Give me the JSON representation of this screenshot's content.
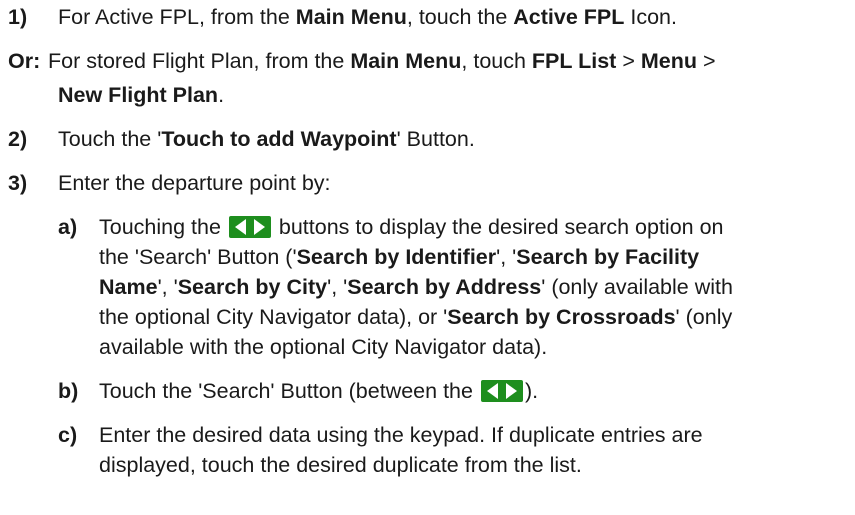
{
  "steps": [
    {
      "num": "1)",
      "segments": [
        "For Active FPL, from the ",
        "Main Menu",
        ", touch the ",
        "Active FPL",
        " Icon."
      ]
    },
    {
      "num": "Or:",
      "line1": [
        "For stored Flight Plan, from the ",
        "Main Menu",
        ", touch ",
        "FPL List",
        " > ",
        "Menu",
        " >"
      ],
      "line2": [
        "New Flight Plan",
        "."
      ]
    },
    {
      "num": "2)",
      "segments": [
        "Touch the '",
        "Touch to add Waypoint",
        "' Button."
      ]
    },
    {
      "num": "3)",
      "segments": [
        "Enter the departure point by:"
      ]
    }
  ],
  "substeps": {
    "a": {
      "num": "a)",
      "l1": [
        "Touching the ",
        " buttons to display the desired search option on"
      ],
      "l2": [
        "the 'Search' Button ('",
        "Search by Identifier",
        "', '",
        "Search by Facility"
      ],
      "l3": [
        "Name",
        "', '",
        "Search by City",
        "',  '",
        "Search by Address",
        "' (only available with"
      ],
      "l4": [
        "the optional City Navigator data), or '",
        "Search by Crossroads",
        "' (only"
      ],
      "l5": [
        "available with the optional City Navigator data)."
      ]
    },
    "b": {
      "num": "b)",
      "l1": [
        "Touch the 'Search' Button (between the ",
        ")."
      ]
    },
    "c": {
      "num": "c)",
      "l1": [
        "Enter the desired data using the keypad.  If duplicate entries are"
      ],
      "l2": [
        "displayed, touch the desired duplicate from the list."
      ]
    }
  },
  "icons": {
    "nav_buttons": "left-right-arrows-icon",
    "color": "#1e8e1e"
  }
}
